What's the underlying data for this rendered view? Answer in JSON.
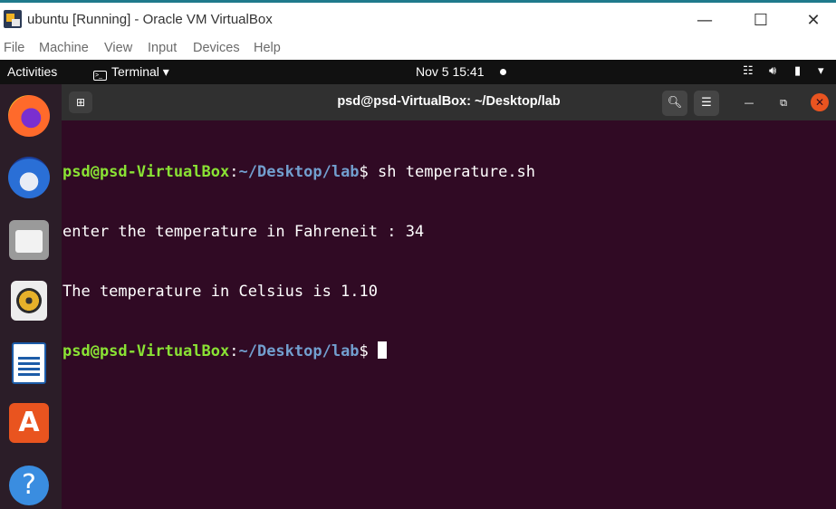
{
  "window": {
    "title": "ubuntu [Running] - Oracle VM VirtualBox",
    "controls": {
      "minimize": "—",
      "maximize": "☐",
      "close": "✕"
    }
  },
  "menubar": {
    "items": [
      "File",
      "Machine",
      "View",
      "Input",
      "Devices",
      "Help"
    ]
  },
  "topbar": {
    "activities": "Activities",
    "app_menu": "Terminal ▾",
    "clock": "Nov 5  15:41",
    "tray_icons": [
      "network-icon",
      "volume-icon",
      "battery-icon",
      "system-menu-icon"
    ]
  },
  "dock": {
    "apps": [
      "firefox-icon",
      "thunderbird-icon",
      "files-icon",
      "rhythmbox-icon",
      "libreoffice-writer-icon",
      "ubuntu-software-icon",
      "help-icon"
    ]
  },
  "terminal": {
    "title": "psd@psd-VirtualBox: ~/Desktop/lab",
    "prompt_user": "psd@psd-VirtualBox",
    "prompt_colon": ":",
    "prompt_path": "~/Desktop/lab",
    "prompt_symbol": "$ ",
    "command": "sh temperature.sh",
    "output": [
      "enter the temperature in Fahreneit : 34",
      "The temperature in Celsius is 1.10"
    ]
  },
  "colors": {
    "terminal_bg": "#300a24",
    "prompt_user": "#8ae234",
    "prompt_path": "#729fcf",
    "close_button": "#e95420"
  }
}
